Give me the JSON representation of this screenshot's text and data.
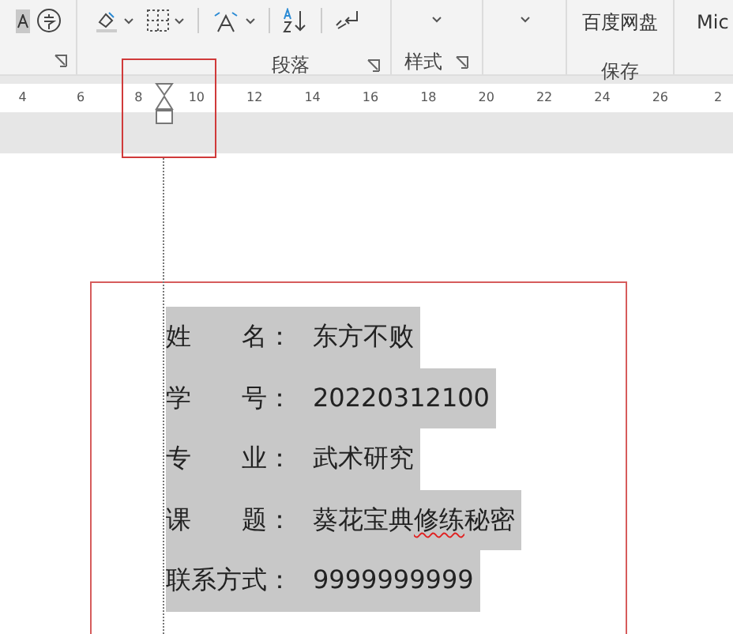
{
  "ribbon": {
    "groups": [
      {
        "label": "段落"
      },
      {
        "label": "样式"
      },
      {
        "label": "保存"
      }
    ],
    "save_button": "百度网盘",
    "partial_group": "Mic"
  },
  "ruler": {
    "ticks": [
      "4",
      "6",
      "8",
      "10",
      "12",
      "14",
      "16",
      "18",
      "20",
      "22",
      "24",
      "26",
      "2"
    ]
  },
  "document": {
    "rows": [
      {
        "label": "姓　　名：",
        "segments": [
          {
            "text": "东方不败",
            "misspelled": false
          }
        ]
      },
      {
        "label": "学　　号：",
        "segments": [
          {
            "text": "20220312100",
            "misspelled": false
          }
        ]
      },
      {
        "label": "专　　业：",
        "segments": [
          {
            "text": "武术研究",
            "misspelled": false
          }
        ]
      },
      {
        "label": "课　　题：",
        "segments": [
          {
            "text": "葵花宝典",
            "misspelled": false
          },
          {
            "text": "修练",
            "misspelled": true
          },
          {
            "text": "秘密",
            "misspelled": false
          }
        ]
      },
      {
        "label": "联系方式：",
        "segments": [
          {
            "text": "9999999999",
            "misspelled": false
          }
        ]
      }
    ]
  }
}
